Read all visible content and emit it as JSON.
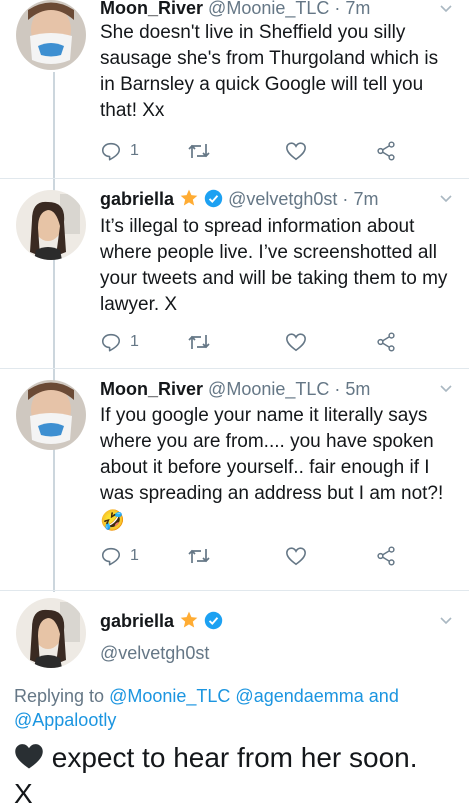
{
  "tweets": [
    {
      "name": "Moon_River",
      "handle": "@Moonie_TLC",
      "sep": "·",
      "time": "7m",
      "text": "She doesn't live in Sheffield you silly sausage she's from Thurgoland which is in Barnsley a quick Google will tell you that! Xx",
      "reply_count": "1"
    },
    {
      "name": "gabriella",
      "handle": "@velvetgh0st",
      "sep": "·",
      "time": "7m",
      "text": "It’s illegal to spread information about where people live. I’ve screenshotted all your tweets and will be taking them to my lawyer. X",
      "reply_count": "1"
    },
    {
      "name": "Moon_River",
      "handle": "@Moonie_TLC",
      "sep": "·",
      "time": "5m",
      "text": "If you google your name it literally says where you are from.... you have spoken about it before yourself.. fair enough if I was spreading an address but I am not?!",
      "emoji": "🤣",
      "reply_count": "1"
    }
  ],
  "main_tweet": {
    "name": "gabriella",
    "handle": "@velvetgh0st",
    "replying_prefix": "Replying to",
    "replying_users": [
      "@Moonie_TLC",
      "@agendaemma",
      "@Appalootly"
    ],
    "replying_and": "and",
    "text": "expect to hear from her soon.",
    "text_line2": "X"
  },
  "colors": {
    "link": "#1b95e0",
    "muted": "#657786",
    "verified": "#1da1f2",
    "star": "#ffac33",
    "heart_emoji": "#292f33"
  },
  "icons": [
    "reply-icon",
    "retweet-icon",
    "like-icon",
    "share-icon",
    "chevron-down-icon",
    "verified-badge-icon",
    "star-icon",
    "black-heart-icon",
    "rofl-emoji"
  ]
}
